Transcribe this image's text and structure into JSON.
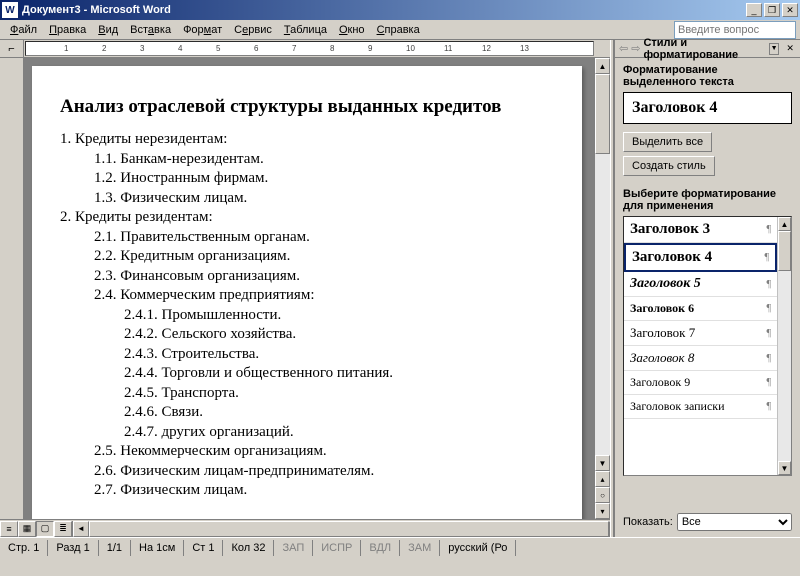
{
  "titlebar": {
    "app_icon": "W",
    "title": "Документ3 - Microsoft Word"
  },
  "menus": {
    "file": "Файл",
    "edit": "Правка",
    "view": "Вид",
    "insert": "Вставка",
    "format": "Формат",
    "tools": "Сервис",
    "table": "Таблица",
    "window": "Окно",
    "help": "Справка"
  },
  "help_input": {
    "placeholder": "Введите вопрос"
  },
  "ruler": {
    "ticks": [
      "1",
      "2",
      "3",
      "4",
      "5",
      "6",
      "7",
      "8",
      "9",
      "10",
      "11",
      "12",
      "13"
    ]
  },
  "document": {
    "heading": "Анализ отраслевой структуры выданных кредитов",
    "lines": [
      {
        "level": 1,
        "text": "1.    Кредиты нерезидентам:"
      },
      {
        "level": 2,
        "text": "1.1.   Банкам-нерезидентам."
      },
      {
        "level": 2,
        "text": "1.2.   Иностранным фирмам."
      },
      {
        "level": 2,
        "text": "1.3.   Физическим лицам."
      },
      {
        "level": 1,
        "text": "2.    Кредиты резидентам:"
      },
      {
        "level": 2,
        "text": "2.1.   Правительственным органам."
      },
      {
        "level": 2,
        "text": "2.2.   Кредитным организациям."
      },
      {
        "level": 2,
        "text": "2.3.   Финансовым организациям."
      },
      {
        "level": 2,
        "text": "2.4.   Коммерческим предприятиям:"
      },
      {
        "level": 3,
        "text": "2.4.1. Промышленности."
      },
      {
        "level": 3,
        "text": "2.4.2. Сельского хозяйства."
      },
      {
        "level": 3,
        "text": "2.4.3. Строительства."
      },
      {
        "level": 3,
        "text": "2.4.4. Торговли и общественного питания."
      },
      {
        "level": 3,
        "text": "2.4.5. Транспорта."
      },
      {
        "level": 3,
        "text": "2.4.6. Связи."
      },
      {
        "level": 3,
        "text": "2.4.7. других организаций."
      },
      {
        "level": 2,
        "text": "2.5.   Некоммерческим организациям."
      },
      {
        "level": 2,
        "text": "2.6.   Физическим лицам-предпринимателям."
      },
      {
        "level": 2,
        "text": "2.7.   Физическим лицам."
      }
    ]
  },
  "taskpane": {
    "title": "Стили и форматирование",
    "formatting_label": "Форматирование выделенного текста",
    "current_style": "Заголовок 4",
    "select_all": "Выделить все",
    "new_style": "Создать стиль",
    "choose_label": "Выберите форматирование для применения",
    "styles": [
      {
        "name": "Заголовок 3",
        "weight": "bold",
        "italic": false,
        "size": 15
      },
      {
        "name": "Заголовок 4",
        "weight": "bold",
        "italic": false,
        "size": 15,
        "selected": true
      },
      {
        "name": "Заголовок 5",
        "weight": "bold",
        "italic": true,
        "size": 14
      },
      {
        "name": "Заголовок 6",
        "weight": "bold",
        "italic": false,
        "size": 12
      },
      {
        "name": "Заголовок 7",
        "weight": "normal",
        "italic": false,
        "size": 13
      },
      {
        "name": "Заголовок 8",
        "weight": "normal",
        "italic": true,
        "size": 13
      },
      {
        "name": "Заголовок 9",
        "weight": "normal",
        "italic": false,
        "size": 12
      },
      {
        "name": "Заголовок записки",
        "weight": "normal",
        "italic": false,
        "size": 12
      }
    ],
    "show_label": "Показать:",
    "show_value": "Все"
  },
  "status": {
    "page": "Стр. 1",
    "section": "Разд 1",
    "pages": "1/1",
    "at": "На 1см",
    "line": "Ст 1",
    "col": "Кол 32",
    "rec": "ЗАП",
    "trk": "ИСПР",
    "ext": "ВДЛ",
    "ovr": "ЗАМ",
    "lang": "русский (Ро"
  }
}
